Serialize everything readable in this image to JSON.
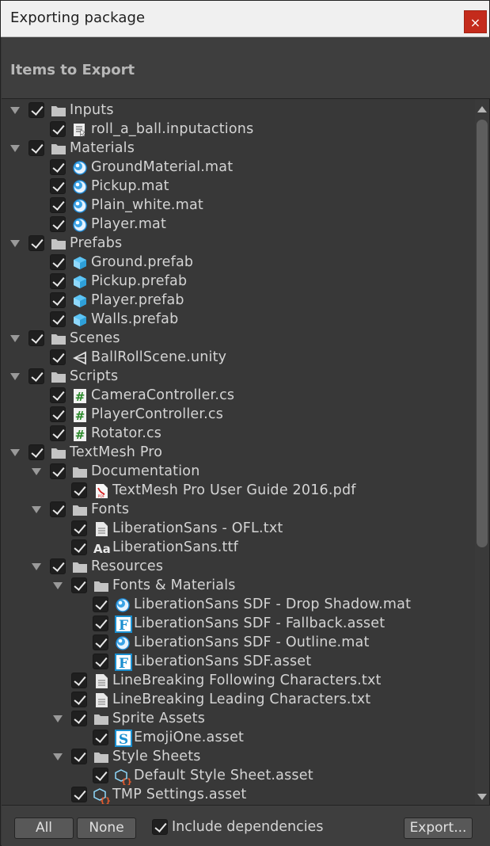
{
  "window": {
    "title": "Exporting package",
    "close_label": "×"
  },
  "header": {
    "title": "Items to Export"
  },
  "tree": {
    "items": [
      {
        "label": "Inputs",
        "depth": 0,
        "type": "folder",
        "checked": true
      },
      {
        "label": "roll_a_ball.inputactions",
        "depth": 1,
        "type": "inputactions",
        "checked": true
      },
      {
        "label": "Materials",
        "depth": 0,
        "type": "folder",
        "checked": true
      },
      {
        "label": "GroundMaterial.mat",
        "depth": 1,
        "type": "material",
        "checked": true
      },
      {
        "label": "Pickup.mat",
        "depth": 1,
        "type": "material",
        "checked": true
      },
      {
        "label": "Plain_white.mat",
        "depth": 1,
        "type": "material",
        "checked": true
      },
      {
        "label": "Player.mat",
        "depth": 1,
        "type": "material",
        "checked": true
      },
      {
        "label": "Prefabs",
        "depth": 0,
        "type": "folder",
        "checked": true
      },
      {
        "label": "Ground.prefab",
        "depth": 1,
        "type": "prefab",
        "checked": true
      },
      {
        "label": "Pickup.prefab",
        "depth": 1,
        "type": "prefab",
        "checked": true
      },
      {
        "label": "Player.prefab",
        "depth": 1,
        "type": "prefab",
        "checked": true
      },
      {
        "label": "Walls.prefab",
        "depth": 1,
        "type": "prefab",
        "checked": true
      },
      {
        "label": "Scenes",
        "depth": 0,
        "type": "folder",
        "checked": true
      },
      {
        "label": "BallRollScene.unity",
        "depth": 1,
        "type": "scene",
        "checked": true
      },
      {
        "label": "Scripts",
        "depth": 0,
        "type": "folder",
        "checked": true
      },
      {
        "label": "CameraController.cs",
        "depth": 1,
        "type": "script",
        "checked": true
      },
      {
        "label": "PlayerController.cs",
        "depth": 1,
        "type": "script",
        "checked": true
      },
      {
        "label": "Rotator.cs",
        "depth": 1,
        "type": "script",
        "checked": true
      },
      {
        "label": "TextMesh Pro",
        "depth": 0,
        "type": "folder",
        "checked": true
      },
      {
        "label": "Documentation",
        "depth": 1,
        "type": "folder",
        "checked": true
      },
      {
        "label": "TextMesh Pro User Guide 2016.pdf",
        "depth": 2,
        "type": "pdf",
        "checked": true
      },
      {
        "label": "Fonts",
        "depth": 1,
        "type": "folder",
        "checked": true
      },
      {
        "label": "LiberationSans - OFL.txt",
        "depth": 2,
        "type": "text",
        "checked": true
      },
      {
        "label": "LiberationSans.ttf",
        "depth": 2,
        "type": "font",
        "checked": true
      },
      {
        "label": "Resources",
        "depth": 1,
        "type": "folder",
        "checked": true
      },
      {
        "label": "Fonts & Materials",
        "depth": 2,
        "type": "folder",
        "checked": true
      },
      {
        "label": "LiberationSans SDF - Drop Shadow.mat",
        "depth": 3,
        "type": "material",
        "checked": true
      },
      {
        "label": "LiberationSans SDF - Fallback.asset",
        "depth": 3,
        "type": "fontasset",
        "checked": true
      },
      {
        "label": "LiberationSans SDF - Outline.mat",
        "depth": 3,
        "type": "material",
        "checked": true
      },
      {
        "label": "LiberationSans SDF.asset",
        "depth": 3,
        "type": "fontasset",
        "checked": true
      },
      {
        "label": "LineBreaking Following Characters.txt",
        "depth": 2,
        "type": "text",
        "checked": true
      },
      {
        "label": "LineBreaking Leading Characters.txt",
        "depth": 2,
        "type": "text",
        "checked": true
      },
      {
        "label": "Sprite Assets",
        "depth": 2,
        "type": "folder",
        "checked": true
      },
      {
        "label": "EmojiOne.asset",
        "depth": 3,
        "type": "spriteasset",
        "checked": true
      },
      {
        "label": "Style Sheets",
        "depth": 2,
        "type": "folder",
        "checked": true
      },
      {
        "label": "Default Style Sheet.asset",
        "depth": 3,
        "type": "stylesheet",
        "checked": true
      },
      {
        "label": "TMP Settings.asset",
        "depth": 2,
        "type": "stylesheet",
        "checked": true
      }
    ]
  },
  "footer": {
    "all_label": "All",
    "none_label": "None",
    "include_dependencies_label": "Include dependencies",
    "include_dependencies_checked": true,
    "export_label": "Export..."
  },
  "colors": {
    "panel_bg": "#383838",
    "titlebar_bg": "#f0f0f0",
    "close_red": "#c42b1c",
    "text": "#d4d4d4",
    "checkbox_bg": "#1f1f1f"
  }
}
